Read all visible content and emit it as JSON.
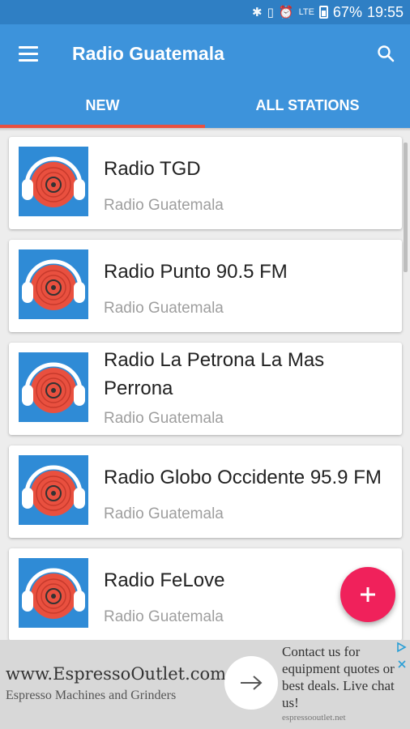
{
  "status_bar": {
    "lte_label": "LTE",
    "battery": "67%",
    "time": "19:55"
  },
  "app_bar": {
    "title": "Radio Guatemala",
    "menu_icon": "hamburger-menu-icon",
    "search_icon": "search-icon"
  },
  "tabs": [
    {
      "label": "NEW",
      "active": true
    },
    {
      "label": "ALL STATIONS",
      "active": false
    }
  ],
  "stations": [
    {
      "name": "Radio TGD",
      "subtitle": "Radio Guatemala"
    },
    {
      "name": "Radio Punto 90.5 FM",
      "subtitle": "Radio Guatemala"
    },
    {
      "name": "Radio La Petrona La Mas Perrona",
      "subtitle": "Radio Guatemala"
    },
    {
      "name": "Radio Globo Occidente 95.9 FM",
      "subtitle": "Radio Guatemala"
    },
    {
      "name": "Radio FeLove",
      "subtitle": "Radio Guatemala"
    }
  ],
  "fab": {
    "icon": "plus-icon"
  },
  "ad": {
    "url": "www.EspressoOutlet.com",
    "description": "Espresso Machines and Grinders",
    "copy": "Contact us for equipment quotes or best deals. Live chat us!",
    "domain": "espressooutlet.net"
  },
  "colors": {
    "primary": "#3d93db",
    "status_bar": "#2f7fc4",
    "tab_indicator": "#e9503f",
    "fab": "#f0215b",
    "logo_bg": "#2f8bd6",
    "logo_disc": "#e9503f"
  }
}
